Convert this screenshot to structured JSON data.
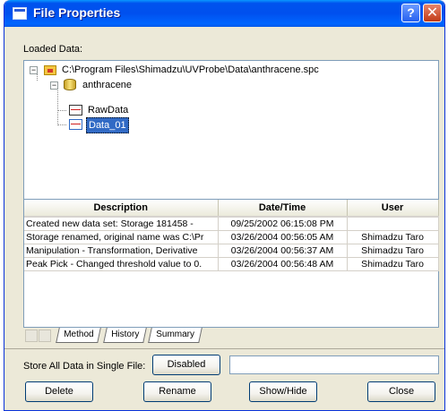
{
  "window": {
    "title": "File Properties",
    "help_glyph": "?",
    "close_glyph": "✕"
  },
  "loaded_data": {
    "label": "Loaded Data:",
    "tree": {
      "file_path": "C:\\Program Files\\Shimadzu\\UVProbe\\Data\\anthracene.spc",
      "node": "anthracene",
      "children": [
        "RawData",
        "Data_01"
      ],
      "selected": "Data_01"
    }
  },
  "history": {
    "columns": [
      "Description",
      "Date/Time",
      "User"
    ],
    "rows": [
      [
        "Created new data set:  Storage 181458 -",
        "09/25/2002 06:15:08 PM",
        ""
      ],
      [
        "Storage renamed, original name was C:\\Pr",
        "03/26/2004 00:56:05 AM",
        "Shimadzu Taro"
      ],
      [
        "Manipulation - Transformation, Derivative",
        "03/26/2004 00:56:37 AM",
        "Shimadzu Taro"
      ],
      [
        "Peak Pick - Changed threshold value to 0.",
        "03/26/2004 00:56:48 AM",
        "Shimadzu Taro"
      ]
    ]
  },
  "tabs": [
    "Method",
    "History",
    "Summary"
  ],
  "active_tab": "History",
  "store": {
    "label": "Store All Data in Single File:",
    "button": "Disabled",
    "textbox_value": ""
  },
  "buttons": {
    "delete": "Delete",
    "rename": "Rename",
    "showhide": "Show/Hide",
    "close": "Close"
  },
  "colors": {
    "title_bar": "#0054e3",
    "selection": "#316ac5",
    "dialog_bg": "#ece9d8"
  }
}
